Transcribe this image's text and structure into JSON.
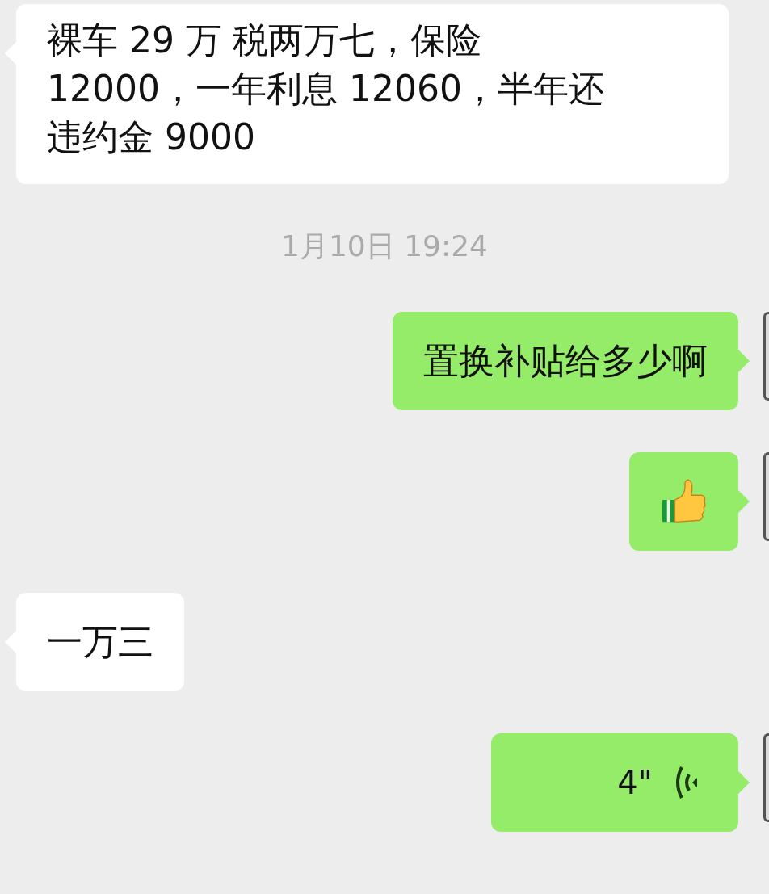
{
  "messages": [
    {
      "kind": "text",
      "outgoing": false,
      "text": " 裸车 29 万 税两万七，保险 12000，一年利息 12060，半年还违约金 9000"
    },
    {
      "kind": "time",
      "text": "1月10日 19:24"
    },
    {
      "kind": "text",
      "outgoing": true,
      "text": "置换补贴给多少啊"
    },
    {
      "kind": "emoji",
      "outgoing": true
    },
    {
      "kind": "text",
      "outgoing": false,
      "text": "一万三"
    },
    {
      "kind": "voice",
      "outgoing": true,
      "text": "4\""
    }
  ]
}
